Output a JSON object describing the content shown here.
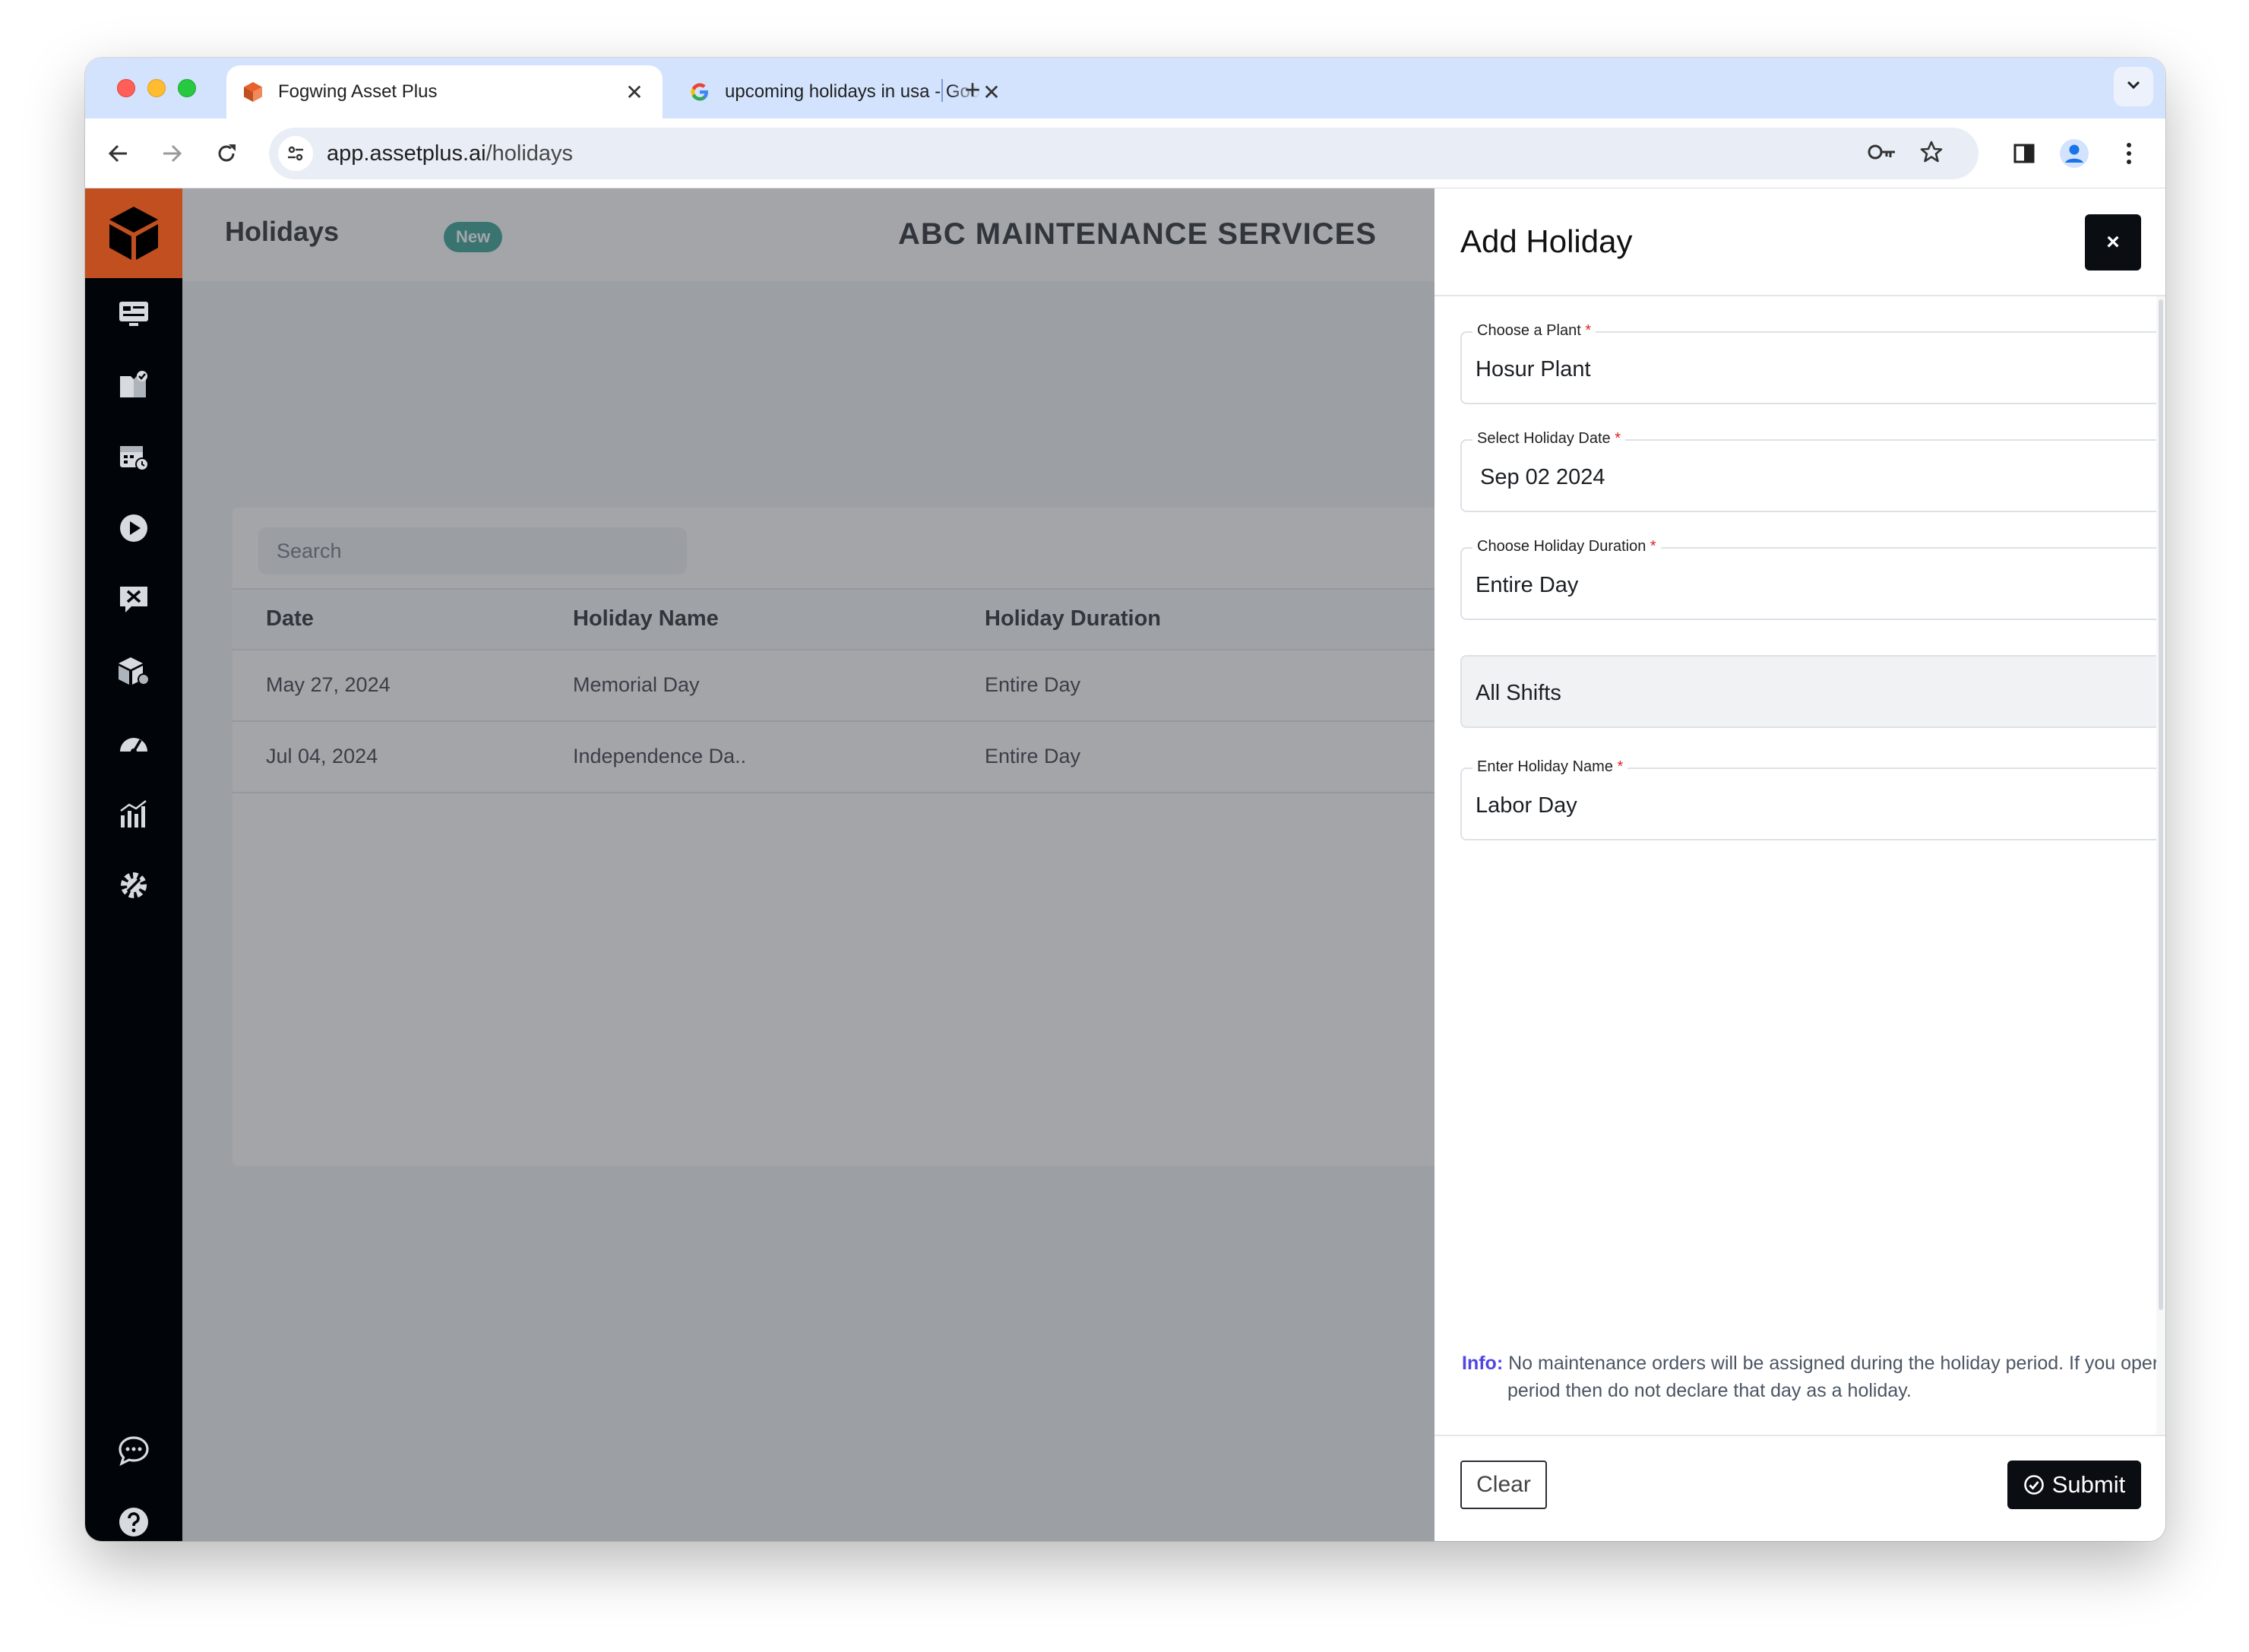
{
  "browser": {
    "tabs": [
      {
        "title": "Fogwing Asset Plus",
        "close": "✕"
      },
      {
        "title": "upcoming holidays in usa - Google",
        "close": "✕"
      }
    ],
    "new_tab": "+",
    "url_host": "app.assetplus.ai",
    "url_path": "/holidays"
  },
  "sidebar": {
    "items": [
      "dashboard-icon",
      "work-orders-icon",
      "calendar-icon",
      "play-icon",
      "maintenance-icon",
      "assets-icon",
      "gauge-icon",
      "analytics-icon",
      "settings-icon"
    ],
    "bottom": [
      "chat-icon",
      "help-icon"
    ]
  },
  "header": {
    "title": "Holidays",
    "badge": "New",
    "company": "ABC MAINTENANCE SERVICES"
  },
  "table": {
    "search_placeholder": "Search",
    "columns": [
      "Date",
      "Holiday Name",
      "Holiday Duration"
    ],
    "rows": [
      [
        "May 27, 2024",
        "Memorial Day",
        "Entire Day"
      ],
      [
        "Jul 04, 2024",
        "Independence Da..",
        "Entire Day"
      ]
    ]
  },
  "drawer": {
    "title": "Add Holiday",
    "close": "×",
    "fields": {
      "plant": {
        "label": "Choose a Plant",
        "required": "*",
        "value": "Hosur Plant"
      },
      "date": {
        "label": "Select Holiday Date",
        "required": "*",
        "value": "Sep 02 2024"
      },
      "duration": {
        "label": "Choose Holiday Duration",
        "required": "*",
        "value": "Entire Day"
      },
      "shifts": {
        "value": "All Shifts"
      },
      "name": {
        "label": "Enter Holiday Name",
        "required": "*",
        "value": "Labor Day"
      }
    },
    "info_label": "Info:",
    "info_text": "No maintenance orders will be assigned during the holiday period. If you operate during holiday period then do not declare that day as a holiday.",
    "clear_label": "Clear",
    "submit_label": "Submit"
  },
  "colors": {
    "brand_orange": "#c14f1f",
    "sidebar_bg": "#010409",
    "badge_teal": "#2a9d8f",
    "info_accent": "#4f46e5",
    "required_red": "#e02424"
  }
}
